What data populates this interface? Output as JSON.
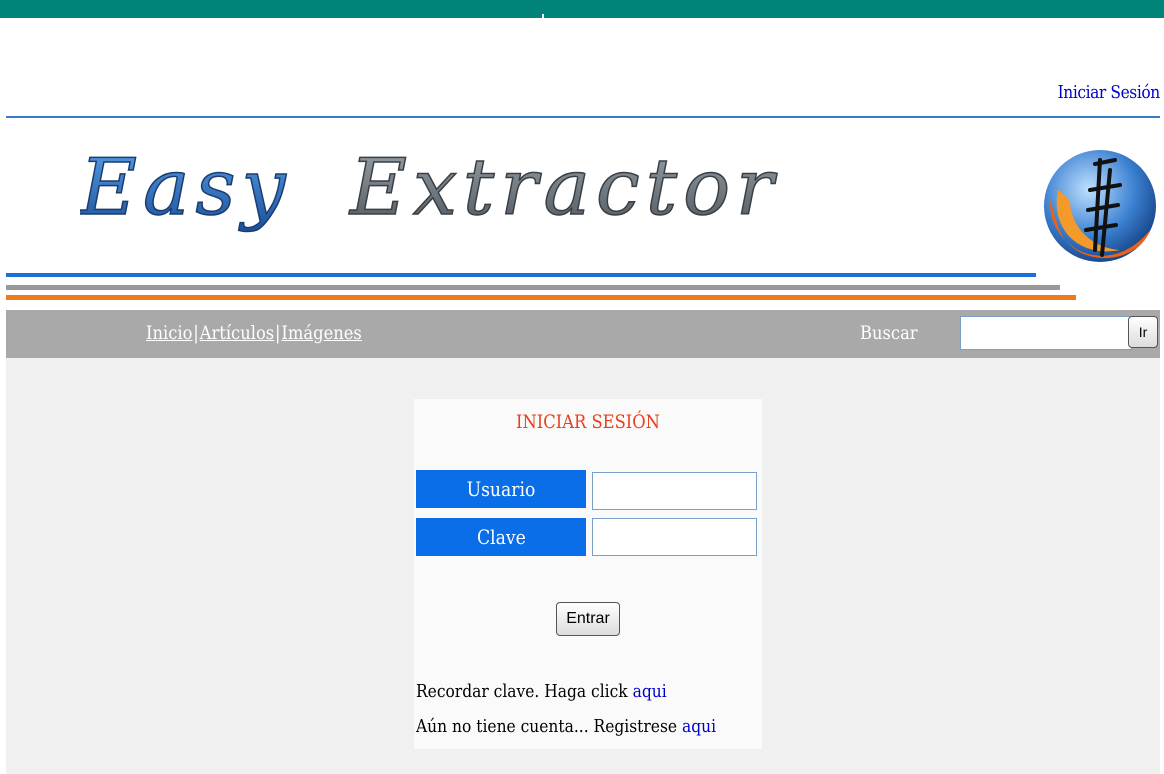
{
  "header": {
    "login_link": "Iniciar Sesión",
    "logo_text": "Easy Extractor"
  },
  "colors": {
    "top_bar": "#00847a",
    "nav_bg": "#a9a9a9",
    "label_bg": "#0a6ee8",
    "title": "#e8401c",
    "link": "#0000cc",
    "stripe_blue": "#1e6fd9",
    "stripe_gray": "#999999",
    "stripe_orange": "#f07a1a"
  },
  "nav": {
    "items": [
      {
        "label": "Inicio"
      },
      {
        "label": "Artículos"
      },
      {
        "label": "Imágenes"
      }
    ],
    "separator": "|",
    "search_label": "Buscar",
    "search_value": "",
    "search_button": "Ir"
  },
  "login": {
    "title": "INICIAR SESIÓN",
    "user_label": "Usuario",
    "user_value": "",
    "pass_label": "Clave",
    "pass_value": "",
    "submit_label": "Entrar",
    "remember_text": "Recordar clave. Haga click",
    "remember_link": "aqui",
    "register_text": "Aún no tiene cuenta... Registrese",
    "register_link": "aqui"
  }
}
